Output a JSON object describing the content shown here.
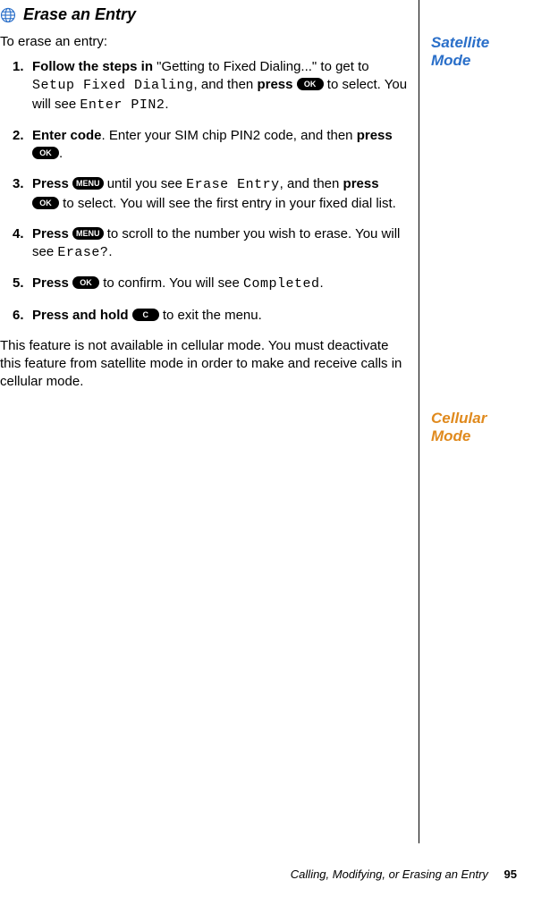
{
  "heading": {
    "title": "Erase an Entry"
  },
  "sidebar": {
    "satellite": "Satellite Mode",
    "cellular": "Cellular Mode"
  },
  "intro": "To erase an entry:",
  "keys": {
    "ok": "OK",
    "menu": "MENU",
    "c": "C"
  },
  "steps": [
    {
      "num": "1.",
      "b1": "Follow the steps in",
      "t1": " \"Getting to Fixed Dialing...\" to get to ",
      "lcd1": "Setup Fixed Dialing",
      "t2": ", and then ",
      "b2": "press",
      "t3": " to select. You will see ",
      "lcd2": "Enter PIN2",
      "t4": "."
    },
    {
      "num": "2.",
      "b1": "Enter code",
      "t1": ". Enter your SIM chip PIN2 code, and then ",
      "b2": "press",
      "t2": "."
    },
    {
      "num": "3.",
      "b1": "Press",
      "t1": " until you see ",
      "lcd1": "Erase Entry",
      "t2": ", and then ",
      "b2": "press",
      "t3": " to select. You will see the first entry in your fixed dial list."
    },
    {
      "num": "4.",
      "b1": "Press",
      "t1": " to scroll to the number you wish to erase. You will see ",
      "lcd1": "Erase?",
      "t2": "."
    },
    {
      "num": "5.",
      "b1": "Press",
      "t1": " to confirm. You will see ",
      "lcd1": "Completed",
      "t2": "."
    },
    {
      "num": "6.",
      "b1": "Press and hold",
      "t1": " to exit the menu."
    }
  ],
  "cellular_note": "This feature is not available in cellular mode. You must deactivate this feature from satellite mode in order to make and receive calls in cellular mode.",
  "footer": {
    "text": "Calling, Modifying, or Erasing an Entry",
    "page": "95"
  }
}
